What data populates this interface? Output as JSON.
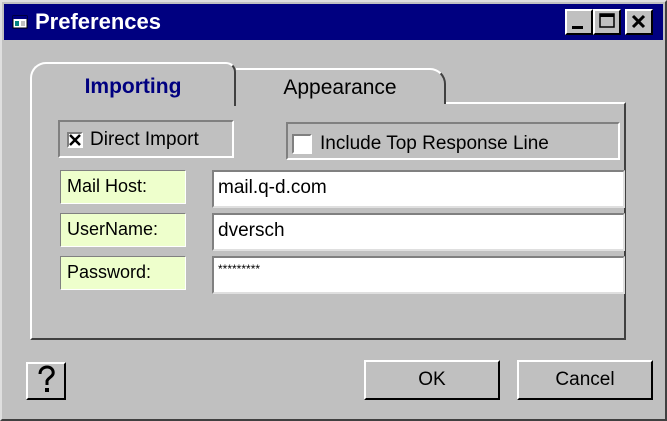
{
  "window": {
    "title": "Preferences",
    "icon": "app-window-icon"
  },
  "controls": {
    "minimize": "minimize-icon",
    "maximize": "maximize-icon",
    "close": "close-icon"
  },
  "tabs": [
    {
      "label": "Importing",
      "selected": true
    },
    {
      "label": "Appearance",
      "selected": false
    }
  ],
  "options": {
    "direct_import": {
      "label": "Direct Import",
      "checked": true
    },
    "include_top_response": {
      "label": "Include Top Response Line",
      "checked": false
    }
  },
  "fields": [
    {
      "label": "Mail Host:",
      "value": "mail.q-d.com"
    },
    {
      "label": "UserName:",
      "value": "dversch"
    },
    {
      "label": "Password:",
      "value": "*********"
    }
  ],
  "buttons": {
    "help_icon": "question-mark-icon",
    "ok": "OK",
    "cancel": "Cancel"
  },
  "colors": {
    "titlebar": "#000080",
    "field_label_bg": "#eeffcc",
    "face": "#c0c0c0",
    "active_tab_text": "#000080"
  }
}
